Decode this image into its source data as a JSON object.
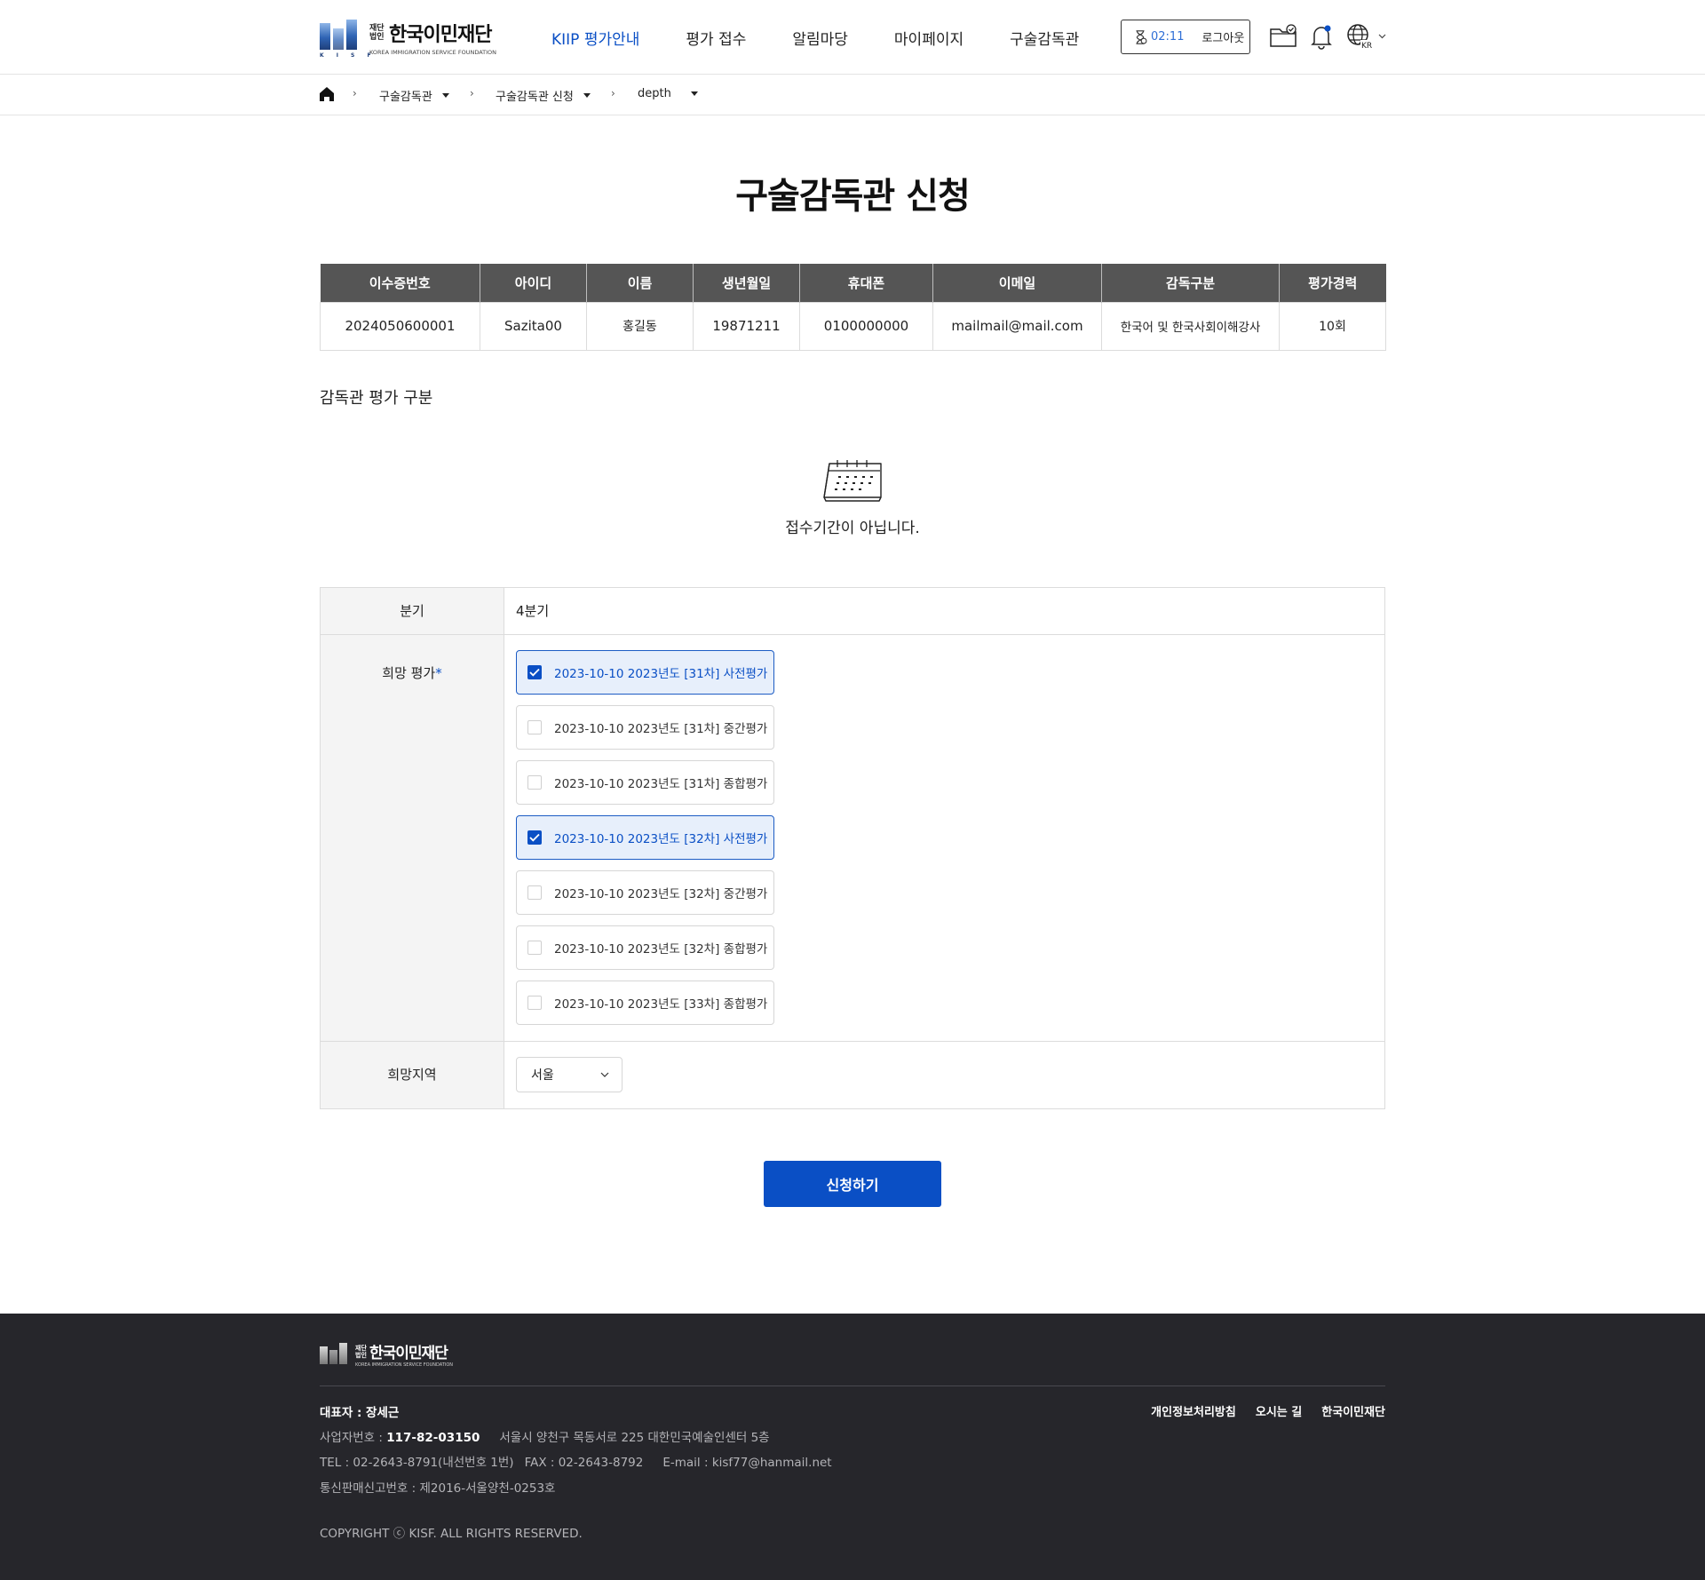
{
  "header": {
    "logo": {
      "corp_small": "재단법인",
      "name": "한국이민재단",
      "english": "KOREA IMMIGRATION SERVICE FOUNDATION",
      "mark": "K I S F"
    },
    "nav": [
      {
        "label": "KIIP 평가안내",
        "active": true
      },
      {
        "label": "평가 접수",
        "active": false
      },
      {
        "label": "알림마당",
        "active": false
      },
      {
        "label": "마이페이지",
        "active": false
      },
      {
        "label": "구술감독관",
        "active": false
      }
    ],
    "timer": "02:11",
    "logout_label": "로그아웃",
    "language": "KR",
    "icons": [
      "timer-icon",
      "folder-check-icon",
      "bell-icon",
      "globe-icon",
      "chevron-down-icon"
    ]
  },
  "breadcrumb": [
    {
      "label": "구술감독관"
    },
    {
      "label": "구술감독관 신청"
    },
    {
      "label": "depth"
    }
  ],
  "page_title": "구술감독관 신청",
  "info_table": {
    "headers": [
      "이수증번호",
      "아이디",
      "이름",
      "생년월일",
      "휴대폰",
      "이메일",
      "감독구분",
      "평가경력"
    ],
    "row": [
      "2024050600001",
      "Sazita00",
      "홍길동",
      "19871211",
      "0100000000",
      "mailmail@mail.com",
      "한국어 및 한국사회이해강사",
      "10회"
    ]
  },
  "section_title": "감독관 평가 구분",
  "empty_state": {
    "icon": "calendar-icon",
    "text": "접수기간이 아닙니다."
  },
  "form": {
    "quarter": {
      "label": "분기",
      "value": "4분기"
    },
    "desired_exam": {
      "label": "희망 평가",
      "required_mark": "*",
      "options": [
        {
          "label": "2023-10-10 2023년도 [31차] 사전평가",
          "checked": true
        },
        {
          "label": "2023-10-10 2023년도 [31차] 중간평가",
          "checked": false
        },
        {
          "label": "2023-10-10 2023년도 [31차] 종합평가",
          "checked": false
        },
        {
          "label": "2023-10-10 2023년도 [32차] 사전평가",
          "checked": true
        },
        {
          "label": "2023-10-10 2023년도 [32차] 중간평가",
          "checked": false
        },
        {
          "label": "2023-10-10 2023년도 [32차] 종합평가",
          "checked": false
        },
        {
          "label": "2023-10-10 2023년도 [33차] 종합평가",
          "checked": false
        }
      ]
    },
    "desired_region": {
      "label": "희망지역",
      "selected": "서울"
    }
  },
  "submit_label": "신청하기",
  "footer": {
    "logo": {
      "corp_small": "재단법인",
      "name": "한국이민재단",
      "english": "KOREA IMMIGRATION SERVICE FOUNDATION",
      "mark": "K I S F"
    },
    "links": [
      "개인정보처리방침",
      "오시는 길",
      "한국이민재단"
    ],
    "representative": "대표자 : 장세근",
    "biz_label": "사업자번호 : ",
    "biz_number": "117-82-03150",
    "address": "서울시 양천구 목동서로 225 대한민국예술인센터 5층",
    "tel": "TEL : 02-2643-8791(내선번호 1번)",
    "fax": "FAX : 02-2643-8792",
    "email": "E-mail : kisf77@hanmail.net",
    "telecom": "통신판매신고번호 : 제2016-서울양천-0253호",
    "copyright": "COPYRIGHT ⓒ KISF. ALL RIGHTS RESERVED."
  },
  "colors": {
    "primary": "#0a4fc5",
    "header_gray": "#555555",
    "footer_bg": "#26262b",
    "selected_bg": "#e7effb"
  }
}
